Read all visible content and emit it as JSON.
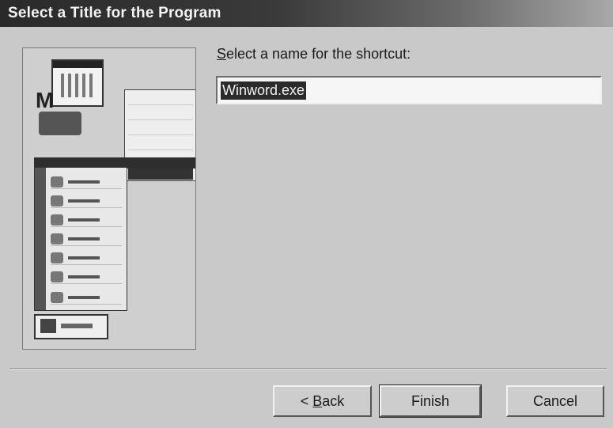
{
  "dialog": {
    "title": "Select a Title for the Program"
  },
  "form": {
    "prompt_prefix": "",
    "prompt_mnemonic": "S",
    "prompt_rest": "elect a name for the shortcut:",
    "name_value": "Winword.exe"
  },
  "buttons": {
    "back_prefix": "< ",
    "back_mnemonic": "B",
    "back_rest": "ack",
    "finish": "Finish",
    "cancel": "Cancel"
  },
  "illustration": {
    "icon": "start-menu-illustration"
  }
}
